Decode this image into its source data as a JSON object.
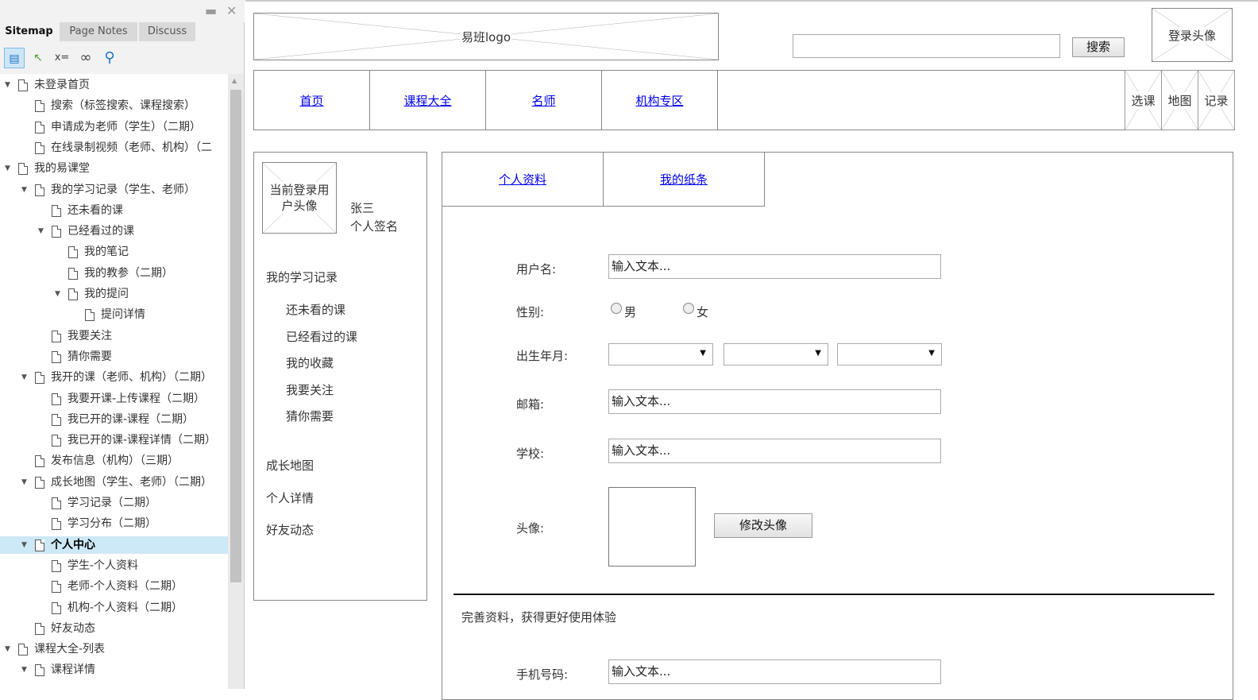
{
  "sitemap": {
    "tabs": [
      "Sitemap",
      "Page Notes",
      "Discuss"
    ],
    "window_buttons": {
      "minimize": "▬",
      "close": "✕"
    },
    "tools": [
      {
        "icon": "sitemap-page-icon",
        "glyph": "▤"
      },
      {
        "icon": "pointer-icon",
        "glyph": "↖"
      },
      {
        "icon": "variables-icon",
        "glyph": "x="
      },
      {
        "icon": "link-icon",
        "glyph": "∞"
      },
      {
        "icon": "search-icon",
        "glyph": "⚲"
      }
    ],
    "nodes": [
      {
        "label": "未登录首页",
        "level": 0,
        "expanded": true
      },
      {
        "label": "搜索（标签搜索、课程搜索）",
        "level": 1
      },
      {
        "label": "申请成为老师（学生）（二期）",
        "level": 1
      },
      {
        "label": "在线录制视频（老师、机构）（二",
        "level": 1
      },
      {
        "label": "我的易课堂",
        "level": 0,
        "expanded": true
      },
      {
        "label": "我的学习记录（学生、老师）",
        "level": 1,
        "expanded": true
      },
      {
        "label": "还未看的课",
        "level": 2
      },
      {
        "label": "已经看过的课",
        "level": 2,
        "expanded": true
      },
      {
        "label": "我的笔记",
        "level": 3
      },
      {
        "label": "我的教参（二期）",
        "level": 3
      },
      {
        "label": "我的提问",
        "level": 3,
        "expanded": true
      },
      {
        "label": "提问详情",
        "level": 4
      },
      {
        "label": "我要关注",
        "level": 2
      },
      {
        "label": "猜你需要",
        "level": 2
      },
      {
        "label": "我开的课（老师、机构）（二期）",
        "level": 1,
        "expanded": true
      },
      {
        "label": "我要开课-上传课程（二期）",
        "level": 2
      },
      {
        "label": "我已开的课-课程（二期）",
        "level": 2
      },
      {
        "label": "我已开的课-课程详情（二期）",
        "level": 2
      },
      {
        "label": "发布信息（机构）（三期）",
        "level": 1
      },
      {
        "label": "成长地图（学生、老师）（二期）",
        "level": 1,
        "expanded": true
      },
      {
        "label": "学习记录（二期）",
        "level": 2
      },
      {
        "label": "学习分布（二期）",
        "level": 2
      },
      {
        "label": "个人中心",
        "level": 1,
        "expanded": true,
        "selected": true
      },
      {
        "label": "学生-个人资料",
        "level": 2
      },
      {
        "label": "老师-个人资料（二期）",
        "level": 2
      },
      {
        "label": "机构-个人资料（二期）",
        "level": 2
      },
      {
        "label": "好友动态",
        "level": 1
      },
      {
        "label": "课程大全-列表",
        "level": 0,
        "expanded": true
      },
      {
        "label": "课程详情",
        "level": 1,
        "expanded": true
      }
    ]
  },
  "header": {
    "logo": "易班logo",
    "search_button": "搜索",
    "login_avatar": "登录头像"
  },
  "nav": {
    "links": [
      "首页",
      "课程大全",
      "名师",
      "机构专区"
    ],
    "quick": [
      "选课",
      "地图",
      "记录"
    ]
  },
  "profile_sidebar": {
    "avatar_label": "当前登录用户头像",
    "name": "张三",
    "signature": "个人签名",
    "section_title": "我的学习记录",
    "sub_items": [
      "还未看的课",
      "已经看过的课",
      "我的收藏",
      "我要关注",
      "猜你需要"
    ],
    "main_items": [
      "成长地图",
      "个人详情",
      "好友动态"
    ]
  },
  "main": {
    "tabs": [
      "个人资料",
      "我的纸条"
    ],
    "form": {
      "username_label": "用户名:",
      "username_value": "输入文本...",
      "gender_label": "性别:",
      "gender_male": "男",
      "gender_female": "女",
      "birth_label": "出生年月:",
      "email_label": "邮箱:",
      "email_value": "输入文本...",
      "school_label": "学校:",
      "school_value": "输入文本...",
      "avatar_label": "头像:",
      "change_avatar_button": "修改头像",
      "complete_hint": "完善资料，获得更好使用体验",
      "phone_label": "手机号码:",
      "phone_value": "输入文本..."
    }
  }
}
